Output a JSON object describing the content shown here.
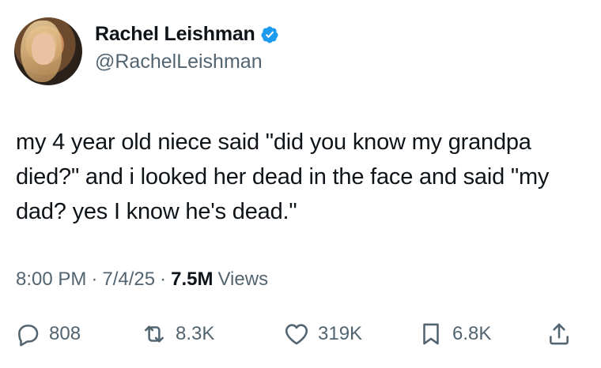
{
  "author": {
    "display_name": "Rachel Leishman",
    "handle": "@RachelLeishman",
    "verified": true
  },
  "tweet": {
    "text": "my 4 year old niece said \"did you know my grandpa died?\" and i looked her dead in the face and said \"my dad? yes I know he's dead.\""
  },
  "meta": {
    "time": "8:00 PM",
    "date": "7/4/25",
    "views_count": "7.5M",
    "views_label": "Views",
    "separator": "·"
  },
  "actions": {
    "replies": "808",
    "reposts": "8.3K",
    "likes": "319K",
    "bookmarks": "6.8K"
  },
  "colors": {
    "text": "#0f1419",
    "secondary": "#536471",
    "verified": "#1d9bf0"
  },
  "icons": [
    "verified-badge-icon",
    "reply-icon",
    "repost-icon",
    "like-icon",
    "bookmark-icon",
    "share-icon"
  ]
}
